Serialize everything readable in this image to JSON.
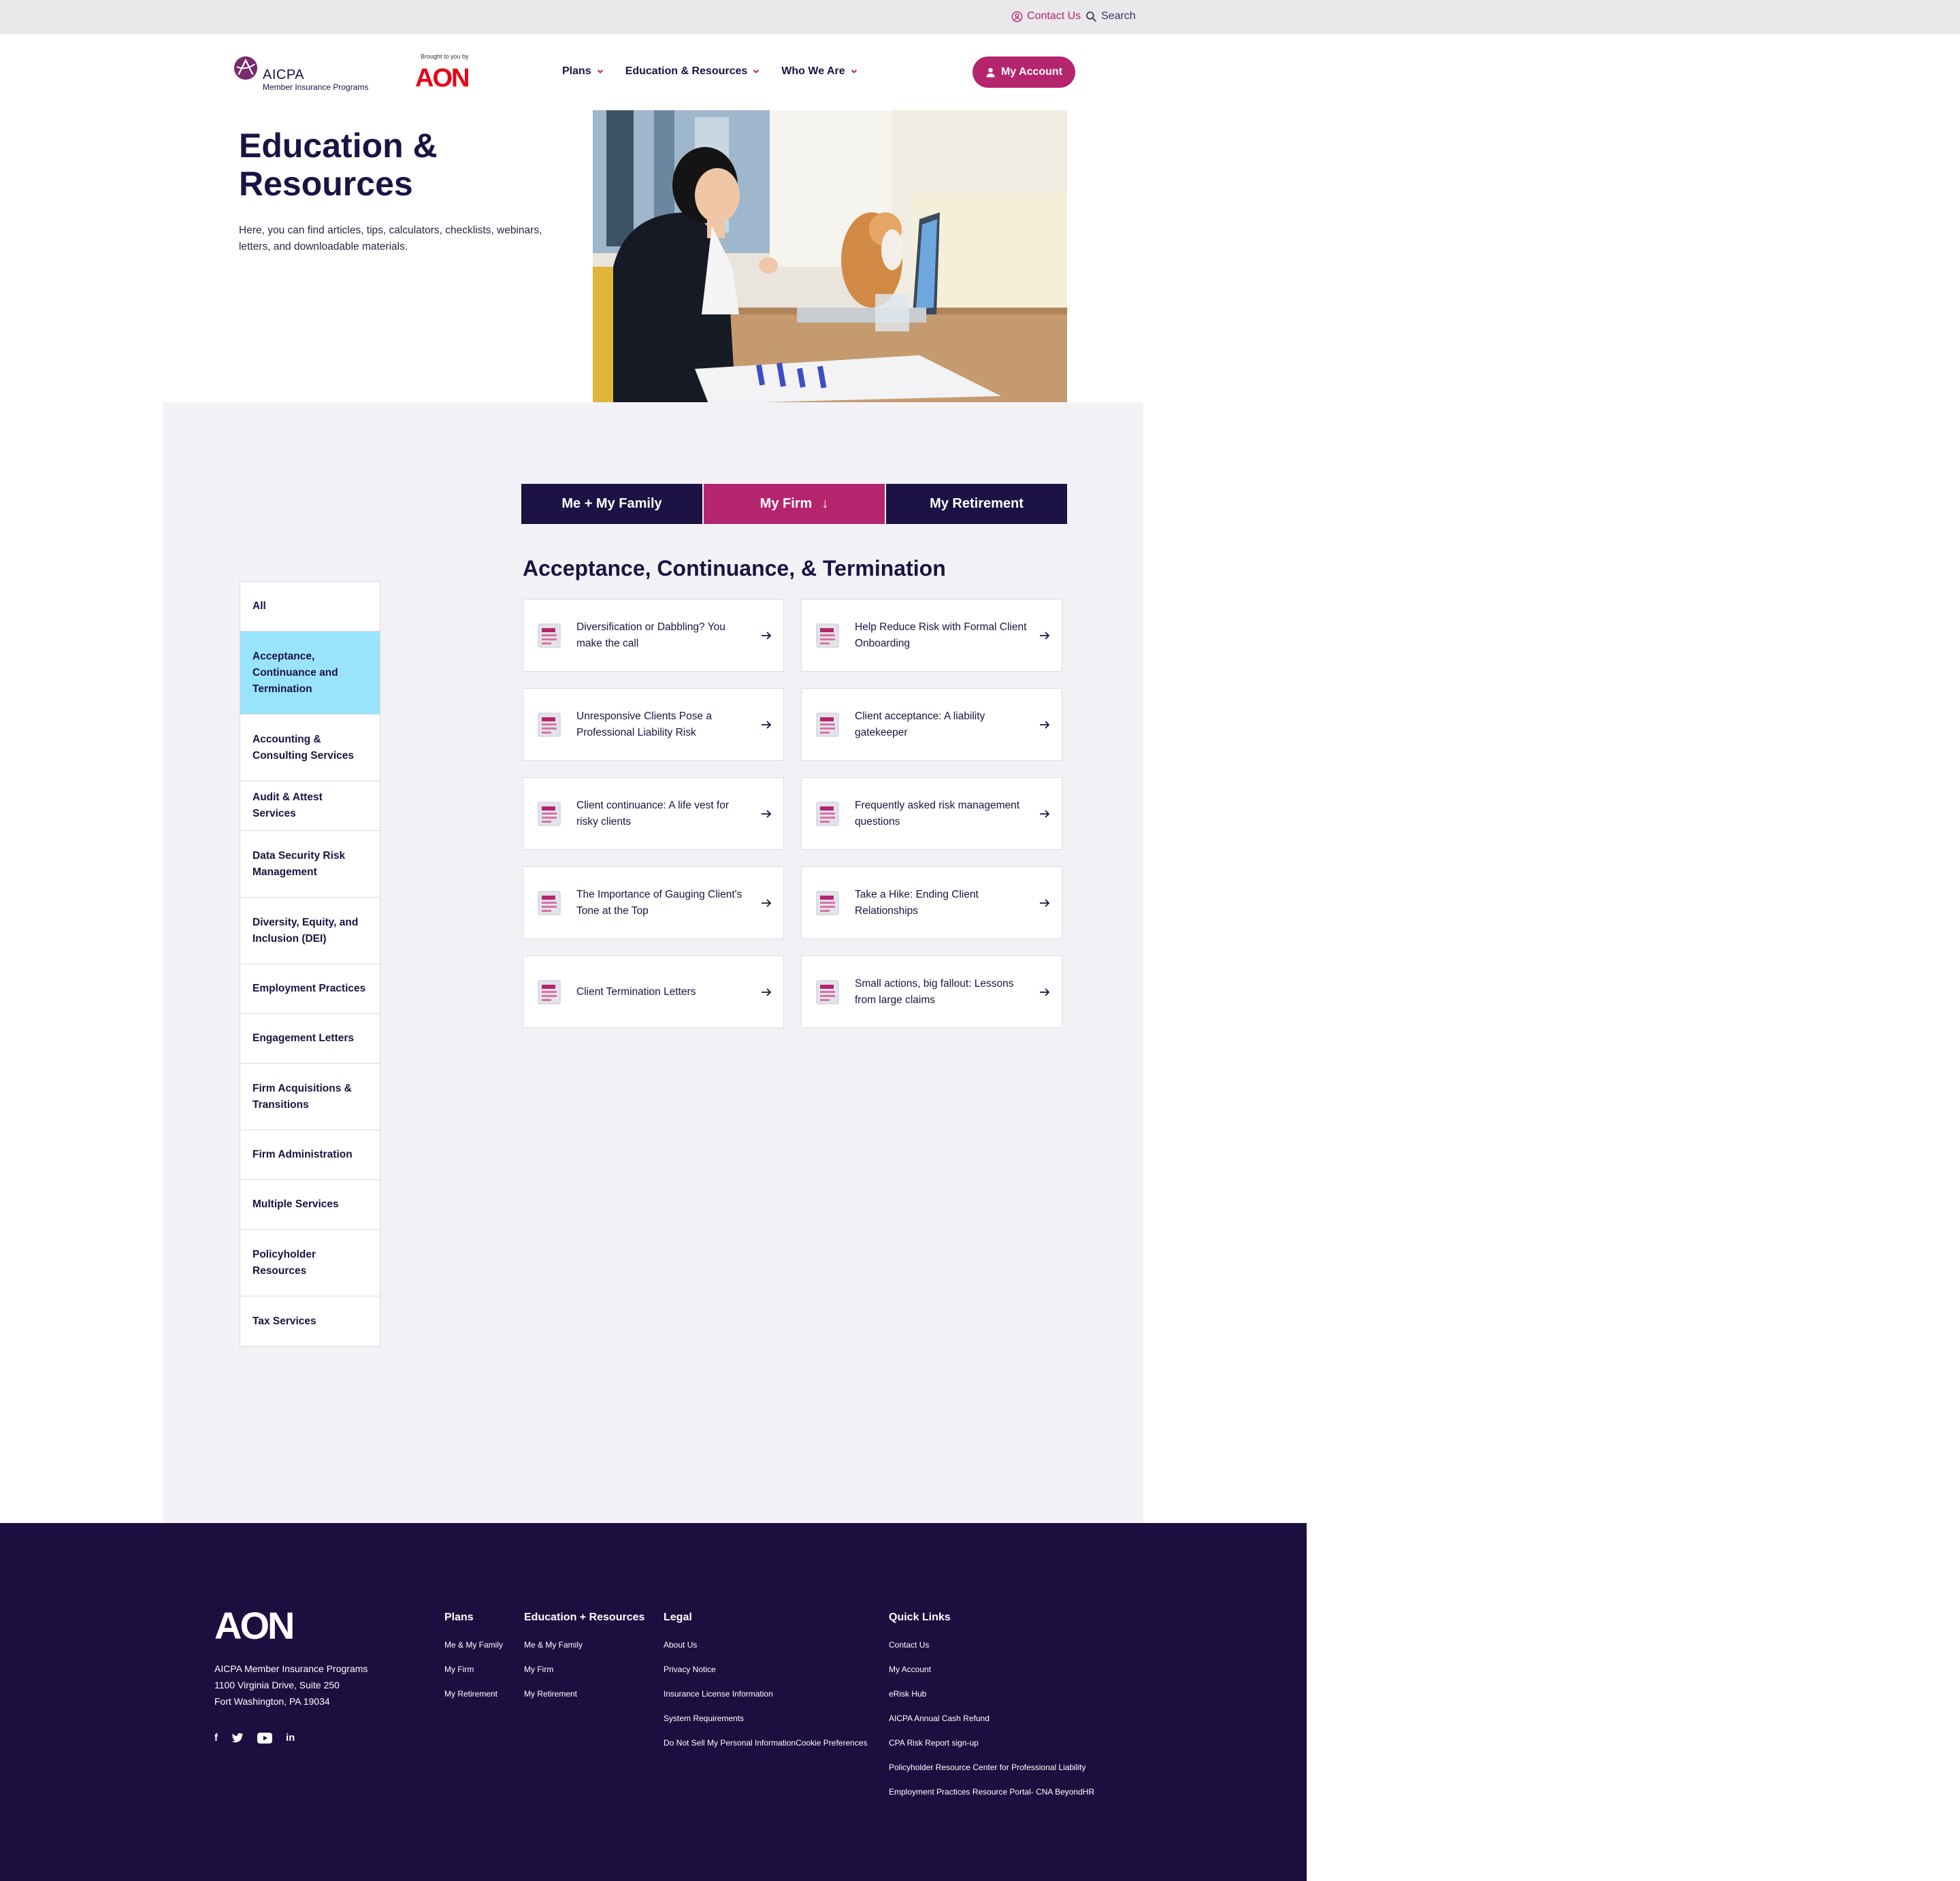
{
  "utility": {
    "contact": "Contact Us",
    "search": "Search"
  },
  "header": {
    "aicpa_word": "AICPA",
    "aicpa_sub": "Member Insurance Programs",
    "brought_by": "Brought to you by",
    "aon_logo": "AON",
    "nav": [
      "Plans",
      "Education & Resources",
      "Who We Are"
    ],
    "account_btn": "My Account"
  },
  "hero": {
    "title": "Education & Resources",
    "description": "Here, you can find articles, tips, calculators, checklists, webinars, letters, and downloadable materials."
  },
  "tabs": [
    {
      "label": "Me + My Family",
      "active": false
    },
    {
      "label": "My Firm",
      "active": true,
      "arrow": "↓"
    },
    {
      "label": "My Retirement",
      "active": false
    }
  ],
  "section_heading": "Acceptance, Continuance, & Termination",
  "sidebar": [
    {
      "label": "All",
      "lines": 1
    },
    {
      "label": "Acceptance, Continuance and Termination",
      "lines": 3,
      "active": true
    },
    {
      "label": "Accounting & Consulting Services",
      "lines": 2
    },
    {
      "label": "Audit & Attest Services",
      "lines": 1
    },
    {
      "label": "Data Security Risk Management",
      "lines": 2
    },
    {
      "label": "Diversity, Equity, and Inclusion (DEI)",
      "lines": 2
    },
    {
      "label": "Employment Practices",
      "lines": 1
    },
    {
      "label": "Engagement Letters",
      "lines": 1
    },
    {
      "label": "Firm Acquisitions & Transitions",
      "lines": 2
    },
    {
      "label": "Firm Administration",
      "lines": 1
    },
    {
      "label": "Multiple Services",
      "lines": 1
    },
    {
      "label": "Policyholder Resources",
      "lines": 2
    },
    {
      "label": "Tax Services",
      "lines": 1
    }
  ],
  "cards": [
    "Diversification or Dabbling? You make the call",
    "Help Reduce Risk with Formal Client Onboarding",
    "Unresponsive Clients Pose a Professional Liability Risk",
    "Client acceptance: A liability gatekeeper",
    "Client continuance: A life vest for risky clients",
    "Frequently asked risk management questions",
    "The Importance of Gauging Client's Tone at the Top",
    "Take a Hike: Ending Client Relationships",
    "Client Termination Letters",
    "Small actions, big fallout: Lessons from large claims"
  ],
  "footer": {
    "logo": "AON",
    "address": [
      "AICPA Member Insurance Programs",
      "1100 Virginia Drive, Suite 250",
      "Fort Washington, PA 19034"
    ],
    "social": [
      "facebook-icon",
      "twitter-icon",
      "youtube-icon",
      "linkedin-icon"
    ],
    "linkedin_text": "in",
    "facebook_text": "f",
    "columns": [
      {
        "title": "Plans",
        "links": [
          "Me & My Family",
          "My Firm",
          "My Retirement"
        ]
      },
      {
        "title": "Education + Resources",
        "links": [
          "Me & My Family",
          "My Firm",
          "My Retirement"
        ]
      },
      {
        "title": "Legal",
        "links": [
          "About Us",
          "Privacy Notice",
          "Insurance License Information",
          "System Requirements",
          "Do Not Sell My Personal InformationCookie Preferences"
        ]
      },
      {
        "title": "Quick Links",
        "links": [
          "Contact Us",
          "My Account",
          "eRisk Hub",
          "AICPA Annual Cash Refund",
          "CPA Risk Report sign-up",
          "Policyholder Resource Center for Professional Liability",
          "Employment Practices Resource Portal- CNA BeyondHR"
        ]
      }
    ]
  },
  "colors": {
    "brand_navy": "#1c1243",
    "accent_magenta": "#b5256e",
    "active_cyan": "#99e4fa",
    "aon_red": "#eb0017",
    "footer_bg": "#1c0f3f"
  }
}
